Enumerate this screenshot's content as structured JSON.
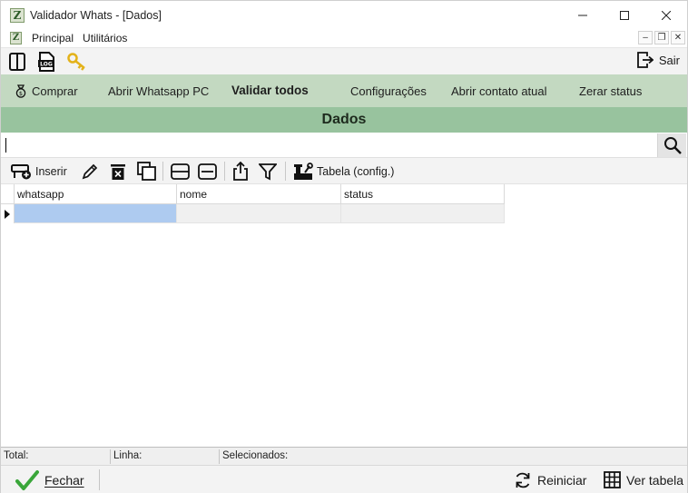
{
  "window": {
    "title": "Validador Whats - [Dados]",
    "logo_letter": "Z"
  },
  "menu": {
    "items": [
      "Principal",
      "Utilitários"
    ],
    "mdi_min": "–",
    "mdi_restore": "❐",
    "mdi_close": "✕"
  },
  "iconbar": {
    "log_text": "LOG",
    "sair_label": "Sair"
  },
  "actions": {
    "comprar": "Comprar",
    "abrir_whatsapp": "Abrir Whatsapp PC",
    "validar_todos": "Validar todos",
    "configuracoes": "Configurações",
    "abrir_contato": "Abrir contato atual",
    "zerar_status": "Zerar status"
  },
  "header": {
    "title": "Dados"
  },
  "search": {
    "value": "",
    "placeholder": ""
  },
  "gridtoolbar": {
    "inserir": "Inserir",
    "tabela": "Tabela (config.)"
  },
  "grid": {
    "columns": [
      "whatsapp",
      "nome",
      "status"
    ],
    "rows": [
      [
        "",
        "",
        ""
      ]
    ]
  },
  "status": {
    "total": "Total:",
    "linha": "Linha:",
    "selecionados": "Selecionados:"
  },
  "footer": {
    "fechar": "Fechar",
    "reiniciar": "Reiniciar",
    "ver_tabela": "Ver tabela"
  },
  "colors": {
    "action_bar": "#c3d9c1",
    "header_band": "#98c39e",
    "selected_cell": "#aecbf0"
  }
}
